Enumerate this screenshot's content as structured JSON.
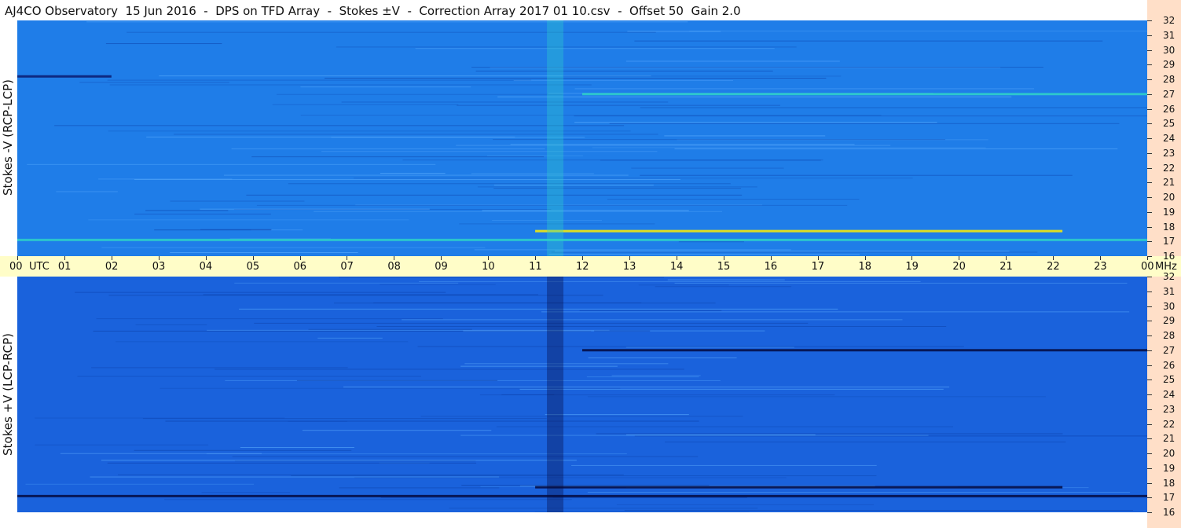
{
  "title": "AJ4CO Observatory  15 Jun 2016  -  DPS on TFD Array  -  Stokes ±V  -  Correction Array 2017 01 10.csv  -  Offset 50  Gain 2.0",
  "chart_data": [
    {
      "type": "heatmap",
      "ylabel": "Stokes -V (RCP-LCP)",
      "x_axis": {
        "label": "UTC",
        "ticks": [
          "00",
          "01",
          "02",
          "03",
          "04",
          "05",
          "06",
          "07",
          "08",
          "09",
          "10",
          "11",
          "12",
          "13",
          "14",
          "15",
          "16",
          "17",
          "18",
          "19",
          "20",
          "21",
          "22",
          "23",
          "00"
        ],
        "range": [
          0,
          24
        ]
      },
      "y_axis": {
        "unit": "MHz",
        "ticks": [
          "16",
          "17",
          "18",
          "19",
          "20",
          "21",
          "22",
          "23",
          "24",
          "25",
          "26",
          "27",
          "28",
          "29",
          "30",
          "31",
          "32"
        ],
        "range": [
          16,
          32
        ]
      },
      "colors": {
        "background": "#1f7de8",
        "hot": "#ffee00",
        "warm": "#2ed0c8",
        "cold": "#0a1a70"
      },
      "features": [
        {
          "kind": "horizontal-band",
          "freq_mhz": 17.7,
          "utc": [
            11.0,
            22.2
          ],
          "intensity": "hot"
        },
        {
          "kind": "horizontal-band",
          "freq_mhz": 17.1,
          "utc": [
            0.0,
            24.0
          ],
          "intensity": "warm"
        },
        {
          "kind": "horizontal-band",
          "freq_mhz": 27.0,
          "utc": [
            12.0,
            24.0
          ],
          "intensity": "warm"
        },
        {
          "kind": "horizontal-band",
          "freq_mhz": 28.2,
          "utc": [
            0.0,
            2.0
          ],
          "intensity": "cold"
        },
        {
          "kind": "vertical-band",
          "utc": [
            11.25,
            11.6
          ],
          "freq_mhz": [
            16,
            32
          ],
          "intensity": "warm"
        }
      ]
    },
    {
      "type": "heatmap",
      "ylabel": "Stokes +V (LCP-RCP)",
      "x_axis": {
        "label": "UTC",
        "ticks": [
          "00",
          "01",
          "02",
          "03",
          "04",
          "05",
          "06",
          "07",
          "08",
          "09",
          "10",
          "11",
          "12",
          "13",
          "14",
          "15",
          "16",
          "17",
          "18",
          "19",
          "20",
          "21",
          "22",
          "23",
          "00"
        ],
        "range": [
          0,
          24
        ]
      },
      "y_axis": {
        "unit": "MHz",
        "ticks": [
          "16",
          "17",
          "18",
          "19",
          "20",
          "21",
          "22",
          "23",
          "24",
          "25",
          "26",
          "27",
          "28",
          "29",
          "30",
          "31",
          "32"
        ],
        "range": [
          16,
          32
        ]
      },
      "colors": {
        "background": "#1a62dc",
        "hot": "#ffee00",
        "warm": "#2ed0c8",
        "cold": "#050a40"
      },
      "features": [
        {
          "kind": "horizontal-band",
          "freq_mhz": 17.7,
          "utc": [
            11.0,
            22.2
          ],
          "intensity": "cold"
        },
        {
          "kind": "horizontal-band",
          "freq_mhz": 17.1,
          "utc": [
            0.0,
            24.0
          ],
          "intensity": "cold"
        },
        {
          "kind": "horizontal-band",
          "freq_mhz": 27.0,
          "utc": [
            12.0,
            24.0
          ],
          "intensity": "cold"
        },
        {
          "kind": "vertical-band",
          "utc": [
            11.25,
            11.6
          ],
          "freq_mhz": [
            16,
            32
          ],
          "intensity": "cold"
        }
      ]
    }
  ],
  "x_labels": {
    "first": "00",
    "utc": "UTC",
    "mhz": "MHz"
  }
}
